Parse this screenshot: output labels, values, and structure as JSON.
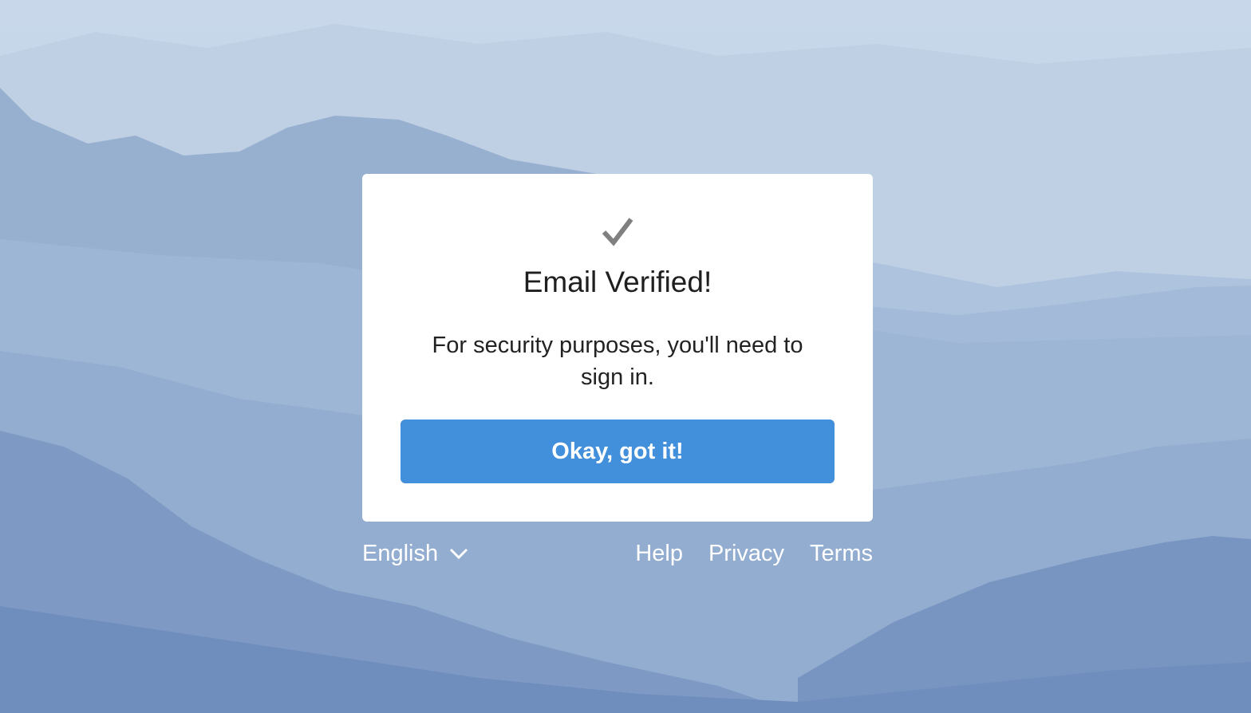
{
  "card": {
    "check_icon": "checkmark-icon",
    "title": "Email Verified!",
    "message": "For security purposes, you'll need to sign in.",
    "button_label": "Okay, got it!"
  },
  "footer": {
    "language": "English",
    "language_icon": "chevron-down-icon",
    "links": [
      "Help",
      "Privacy",
      "Terms"
    ]
  },
  "colors": {
    "button": "#428fdb",
    "card": "#ffffff",
    "footer_text": "#ffffff",
    "sky": "#c4d6e9"
  }
}
